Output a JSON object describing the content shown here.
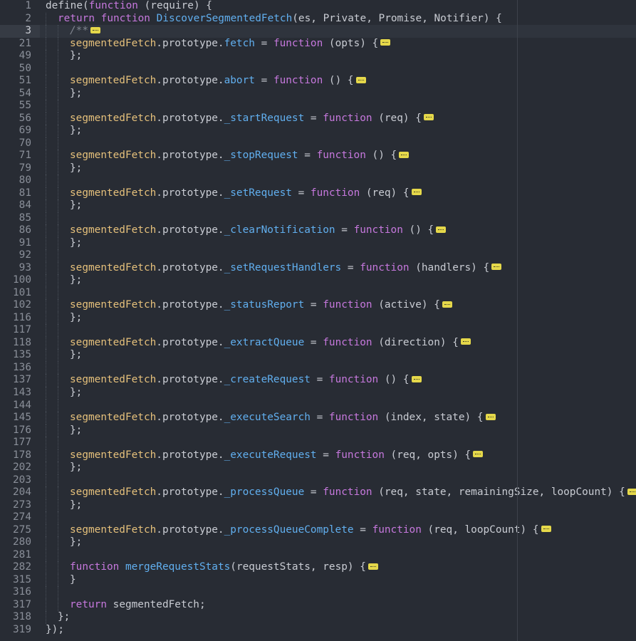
{
  "editor": {
    "lines": [
      {
        "num": "1",
        "indent": 0,
        "active": false,
        "tokens": [
          [
            "define(",
            "plain"
          ],
          [
            "function",
            "kw"
          ],
          [
            " (require) {",
            "plain"
          ]
        ]
      },
      {
        "num": "2",
        "indent": 1,
        "active": false,
        "tokens": [
          [
            "return ",
            "kw"
          ],
          [
            "function ",
            "kw"
          ],
          [
            "DiscoverSegmentedFetch",
            "fn"
          ],
          [
            "(es, Private, Promise, Notifier) {",
            "plain"
          ]
        ]
      },
      {
        "num": "3",
        "indent": 2,
        "active": true,
        "fold": true,
        "tokens": [
          [
            "/**",
            "comment"
          ]
        ]
      },
      {
        "num": "21",
        "indent": 2,
        "fold": true,
        "tokens": [
          [
            "segmentedFetch",
            "var"
          ],
          [
            ".prototype.",
            "plain"
          ],
          [
            "fetch",
            "prop"
          ],
          [
            " = ",
            "plain"
          ],
          [
            "function",
            "kw"
          ],
          [
            " (opts) {",
            "plain"
          ]
        ]
      },
      {
        "num": "49",
        "indent": 2,
        "tokens": [
          [
            "};",
            "plain"
          ]
        ]
      },
      {
        "num": "50",
        "indent": 2,
        "tokens": []
      },
      {
        "num": "51",
        "indent": 2,
        "fold": true,
        "tokens": [
          [
            "segmentedFetch",
            "var"
          ],
          [
            ".prototype.",
            "plain"
          ],
          [
            "abort",
            "prop"
          ],
          [
            " = ",
            "plain"
          ],
          [
            "function",
            "kw"
          ],
          [
            " () {",
            "plain"
          ]
        ]
      },
      {
        "num": "54",
        "indent": 2,
        "tokens": [
          [
            "};",
            "plain"
          ]
        ]
      },
      {
        "num": "55",
        "indent": 2,
        "tokens": []
      },
      {
        "num": "56",
        "indent": 2,
        "fold": true,
        "tokens": [
          [
            "segmentedFetch",
            "var"
          ],
          [
            ".prototype.",
            "plain"
          ],
          [
            "_startRequest",
            "prop"
          ],
          [
            " = ",
            "plain"
          ],
          [
            "function",
            "kw"
          ],
          [
            " (req) {",
            "plain"
          ]
        ]
      },
      {
        "num": "69",
        "indent": 2,
        "tokens": [
          [
            "};",
            "plain"
          ]
        ]
      },
      {
        "num": "70",
        "indent": 2,
        "tokens": []
      },
      {
        "num": "71",
        "indent": 2,
        "fold": true,
        "tokens": [
          [
            "segmentedFetch",
            "var"
          ],
          [
            ".prototype.",
            "plain"
          ],
          [
            "_stopRequest",
            "prop"
          ],
          [
            " = ",
            "plain"
          ],
          [
            "function",
            "kw"
          ],
          [
            " () {",
            "plain"
          ]
        ]
      },
      {
        "num": "79",
        "indent": 2,
        "tokens": [
          [
            "};",
            "plain"
          ]
        ]
      },
      {
        "num": "80",
        "indent": 2,
        "tokens": []
      },
      {
        "num": "81",
        "indent": 2,
        "fold": true,
        "tokens": [
          [
            "segmentedFetch",
            "var"
          ],
          [
            ".prototype.",
            "plain"
          ],
          [
            "_setRequest",
            "prop"
          ],
          [
            " = ",
            "plain"
          ],
          [
            "function",
            "kw"
          ],
          [
            " (req) {",
            "plain"
          ]
        ]
      },
      {
        "num": "84",
        "indent": 2,
        "tokens": [
          [
            "};",
            "plain"
          ]
        ]
      },
      {
        "num": "85",
        "indent": 2,
        "tokens": []
      },
      {
        "num": "86",
        "indent": 2,
        "fold": true,
        "tokens": [
          [
            "segmentedFetch",
            "var"
          ],
          [
            ".prototype.",
            "plain"
          ],
          [
            "_clearNotification",
            "prop"
          ],
          [
            " = ",
            "plain"
          ],
          [
            "function",
            "kw"
          ],
          [
            " () {",
            "plain"
          ]
        ]
      },
      {
        "num": "91",
        "indent": 2,
        "tokens": [
          [
            "};",
            "plain"
          ]
        ]
      },
      {
        "num": "92",
        "indent": 2,
        "tokens": []
      },
      {
        "num": "93",
        "indent": 2,
        "fold": true,
        "tokens": [
          [
            "segmentedFetch",
            "var"
          ],
          [
            ".prototype.",
            "plain"
          ],
          [
            "_setRequestHandlers",
            "prop"
          ],
          [
            " = ",
            "plain"
          ],
          [
            "function",
            "kw"
          ],
          [
            " (handlers) {",
            "plain"
          ]
        ]
      },
      {
        "num": "100",
        "indent": 2,
        "tokens": [
          [
            "};",
            "plain"
          ]
        ]
      },
      {
        "num": "101",
        "indent": 2,
        "tokens": []
      },
      {
        "num": "102",
        "indent": 2,
        "fold": true,
        "tokens": [
          [
            "segmentedFetch",
            "var"
          ],
          [
            ".prototype.",
            "plain"
          ],
          [
            "_statusReport",
            "prop"
          ],
          [
            " = ",
            "plain"
          ],
          [
            "function",
            "kw"
          ],
          [
            " (active) {",
            "plain"
          ]
        ]
      },
      {
        "num": "116",
        "indent": 2,
        "tokens": [
          [
            "};",
            "plain"
          ]
        ]
      },
      {
        "num": "117",
        "indent": 2,
        "tokens": []
      },
      {
        "num": "118",
        "indent": 2,
        "fold": true,
        "tokens": [
          [
            "segmentedFetch",
            "var"
          ],
          [
            ".prototype.",
            "plain"
          ],
          [
            "_extractQueue",
            "prop"
          ],
          [
            " = ",
            "plain"
          ],
          [
            "function",
            "kw"
          ],
          [
            " (direction) {",
            "plain"
          ]
        ]
      },
      {
        "num": "135",
        "indent": 2,
        "tokens": [
          [
            "};",
            "plain"
          ]
        ]
      },
      {
        "num": "136",
        "indent": 2,
        "tokens": []
      },
      {
        "num": "137",
        "indent": 2,
        "fold": true,
        "tokens": [
          [
            "segmentedFetch",
            "var"
          ],
          [
            ".prototype.",
            "plain"
          ],
          [
            "_createRequest",
            "prop"
          ],
          [
            " = ",
            "plain"
          ],
          [
            "function",
            "kw"
          ],
          [
            " () {",
            "plain"
          ]
        ]
      },
      {
        "num": "143",
        "indent": 2,
        "tokens": [
          [
            "};",
            "plain"
          ]
        ]
      },
      {
        "num": "144",
        "indent": 2,
        "tokens": []
      },
      {
        "num": "145",
        "indent": 2,
        "fold": true,
        "tokens": [
          [
            "segmentedFetch",
            "var"
          ],
          [
            ".prototype.",
            "plain"
          ],
          [
            "_executeSearch",
            "prop"
          ],
          [
            " = ",
            "plain"
          ],
          [
            "function",
            "kw"
          ],
          [
            " (index, state) {",
            "plain"
          ]
        ]
      },
      {
        "num": "176",
        "indent": 2,
        "tokens": [
          [
            "};",
            "plain"
          ]
        ]
      },
      {
        "num": "177",
        "indent": 2,
        "tokens": []
      },
      {
        "num": "178",
        "indent": 2,
        "fold": true,
        "tokens": [
          [
            "segmentedFetch",
            "var"
          ],
          [
            ".prototype.",
            "plain"
          ],
          [
            "_executeRequest",
            "prop"
          ],
          [
            " = ",
            "plain"
          ],
          [
            "function",
            "kw"
          ],
          [
            " (req, opts) {",
            "plain"
          ]
        ]
      },
      {
        "num": "202",
        "indent": 2,
        "tokens": [
          [
            "};",
            "plain"
          ]
        ]
      },
      {
        "num": "203",
        "indent": 2,
        "tokens": []
      },
      {
        "num": "204",
        "indent": 2,
        "fold": true,
        "tokens": [
          [
            "segmentedFetch",
            "var"
          ],
          [
            ".prototype.",
            "plain"
          ],
          [
            "_processQueue",
            "prop"
          ],
          [
            " = ",
            "plain"
          ],
          [
            "function",
            "kw"
          ],
          [
            " (req, state, remainingSize, loopCount) {",
            "plain"
          ]
        ]
      },
      {
        "num": "273",
        "indent": 2,
        "tokens": [
          [
            "};",
            "plain"
          ]
        ]
      },
      {
        "num": "274",
        "indent": 2,
        "tokens": []
      },
      {
        "num": "275",
        "indent": 2,
        "fold": true,
        "tokens": [
          [
            "segmentedFetch",
            "var"
          ],
          [
            ".prototype.",
            "plain"
          ],
          [
            "_processQueueComplete",
            "prop"
          ],
          [
            " = ",
            "plain"
          ],
          [
            "function",
            "kw"
          ],
          [
            " (req, loopCount) {",
            "plain"
          ]
        ]
      },
      {
        "num": "280",
        "indent": 2,
        "tokens": [
          [
            "};",
            "plain"
          ]
        ]
      },
      {
        "num": "281",
        "indent": 2,
        "tokens": []
      },
      {
        "num": "282",
        "indent": 2,
        "fold": true,
        "tokens": [
          [
            "function ",
            "kw"
          ],
          [
            "mergeRequestStats",
            "fn"
          ],
          [
            "(requestStats, resp) {",
            "plain"
          ]
        ]
      },
      {
        "num": "315",
        "indent": 2,
        "tokens": [
          [
            "}",
            "plain"
          ]
        ]
      },
      {
        "num": "316",
        "indent": 2,
        "tokens": []
      },
      {
        "num": "317",
        "indent": 2,
        "tokens": [
          [
            "return ",
            "kw"
          ],
          [
            "segmentedFetch;",
            "plain"
          ]
        ]
      },
      {
        "num": "318",
        "indent": 1,
        "tokens": [
          [
            "};",
            "plain"
          ]
        ]
      },
      {
        "num": "319",
        "indent": 0,
        "tokens": [
          [
            "});",
            "plain"
          ]
        ]
      }
    ]
  },
  "colors": {
    "background": "#282c34",
    "gutter_text": "#8a8f99",
    "keyword": "#c678dd",
    "function_name": "#61afef",
    "variable": "#e5c07b",
    "plain": "#c9ccd3",
    "comment": "#7f848e",
    "fold_badge": "#e5d84a"
  }
}
